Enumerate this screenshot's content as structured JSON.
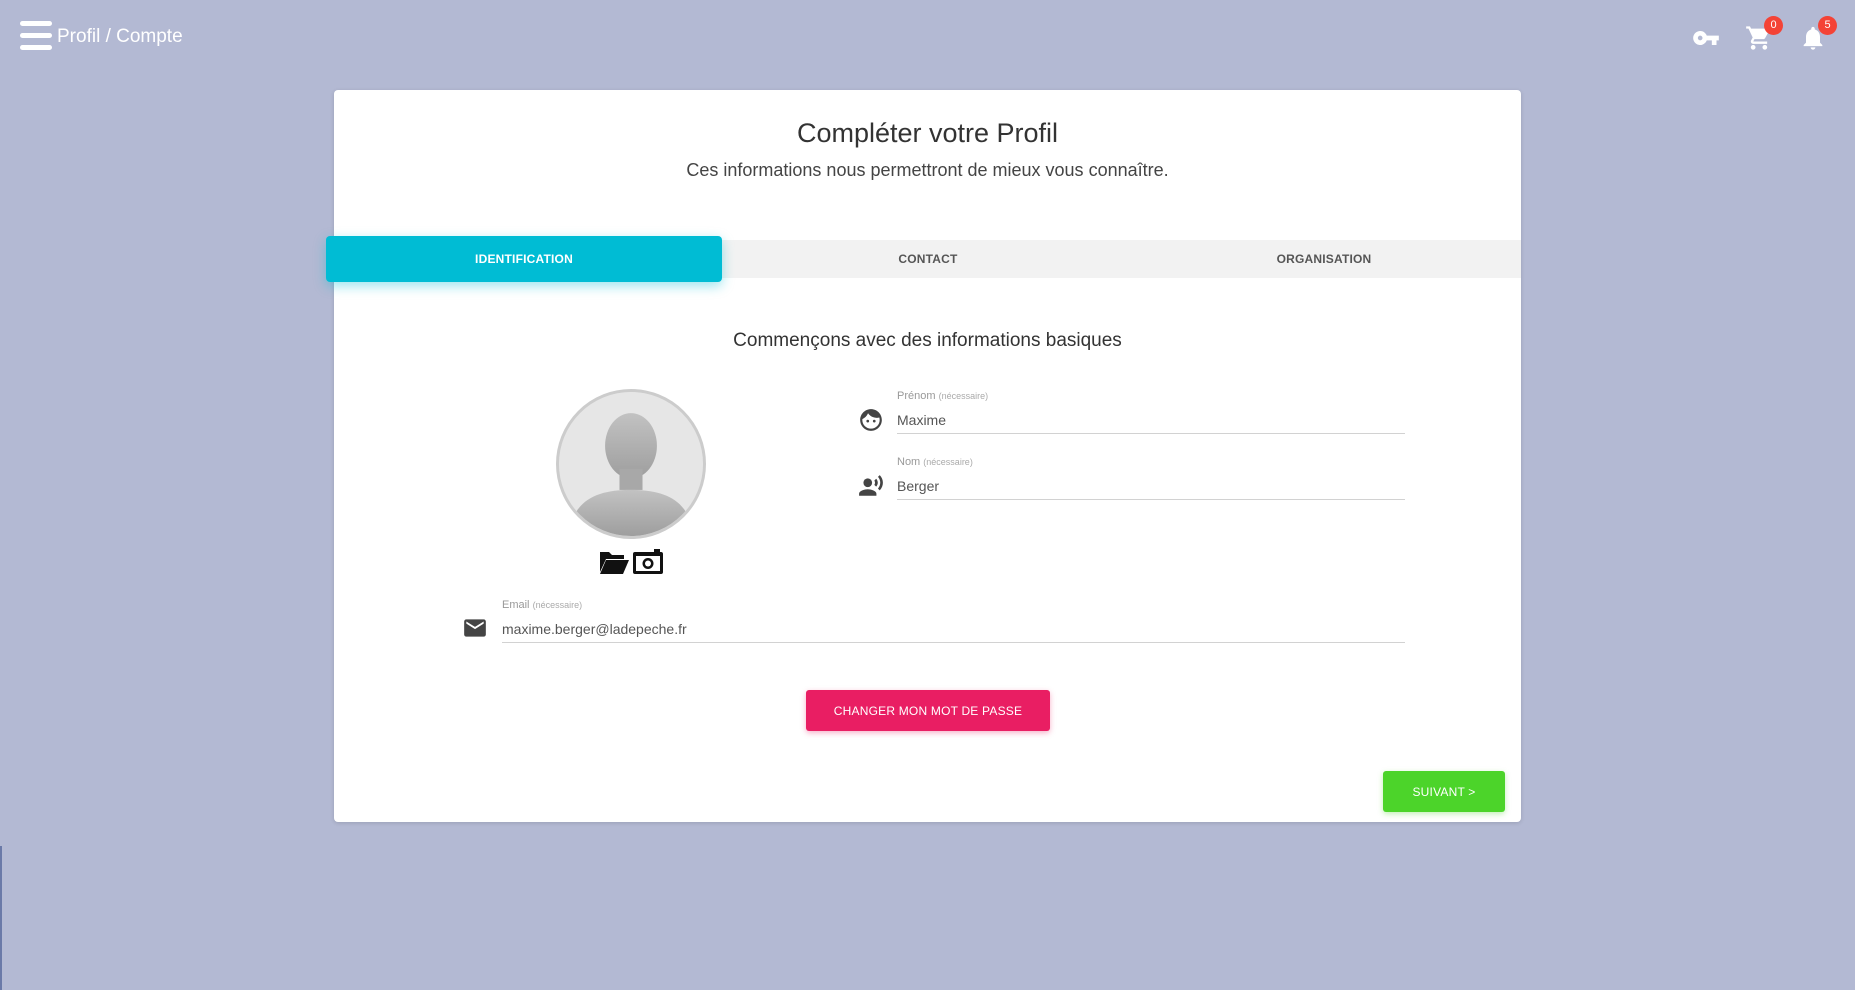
{
  "header": {
    "breadcrumb": "Profil / Compte",
    "cart_count": "0",
    "notifications_count": "5"
  },
  "card": {
    "title": "Compléter votre Profil",
    "subtitle": "Ces informations nous permettront de mieux vous connaître."
  },
  "tabs": [
    {
      "label": "IDENTIFICATION",
      "active": true
    },
    {
      "label": "CONTACT",
      "active": false
    },
    {
      "label": "ORGANISATION",
      "active": false
    }
  ],
  "section_title": "Commençons avec des informations basiques",
  "fields": {
    "prenom": {
      "label": "Prénom",
      "hint": "(nécessaire)",
      "value": "Maxime"
    },
    "nom": {
      "label": "Nom",
      "hint": "(nécessaire)",
      "value": "Berger"
    },
    "email": {
      "label": "Email",
      "hint": "(nécessaire)",
      "value": "maxime.berger@ladepeche.fr"
    }
  },
  "buttons": {
    "change_password": "CHANGER MON MOT DE PASSE",
    "next": "SUIVANT >"
  },
  "colors": {
    "background": "#b3b9d3",
    "tab_active": "#00bcd4",
    "primary_pink": "#e91e63",
    "success_green": "#4cd42a",
    "badge_red": "#f44336"
  },
  "icons": {
    "menu": "hamburger-icon",
    "key": "key-icon",
    "cart": "cart-icon",
    "bell": "bell-icon",
    "face": "face-icon",
    "voice": "record-voice-icon",
    "mail": "mail-icon",
    "folder": "folder-open-icon",
    "camera": "camera-icon"
  }
}
